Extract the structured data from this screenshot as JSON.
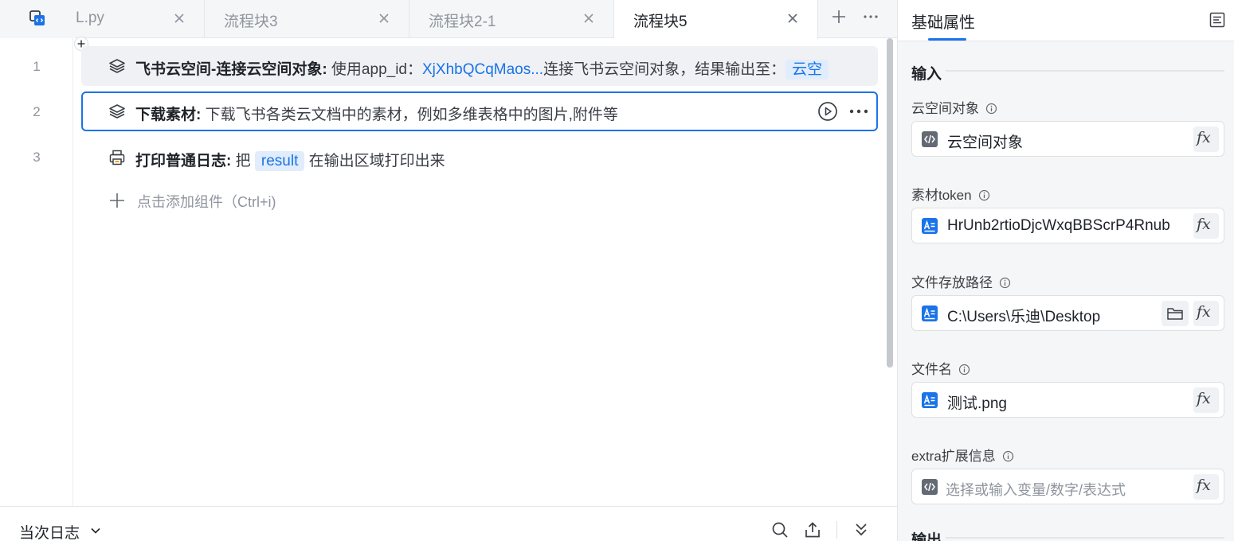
{
  "tabs": [
    {
      "label": "L.py",
      "active": false
    },
    {
      "label": "流程块3",
      "active": false
    },
    {
      "label": "流程块2-1",
      "active": false
    },
    {
      "label": "流程块5",
      "active": true
    }
  ],
  "editor": {
    "line_numbers": [
      "1",
      "2",
      "3"
    ],
    "row1": {
      "title": "飞书云空间-连接云空间对象:",
      "text_before": " 使用app_id：",
      "link": "XjXhbQCqMaos...",
      "text_after": "连接飞书云空间对象，结果输出至：",
      "chip": "云空"
    },
    "row2": {
      "title": "下载素材:",
      "text": " 下载飞书各类云文档中的素材，例如多维表格中的图片,附件等"
    },
    "row3": {
      "title": "打印普通日志:",
      "text_before": " 把",
      "chip": "result",
      "text_after": "在输出区域打印出来"
    },
    "add_component": "点击添加组件（Ctrl+i)"
  },
  "bottom": {
    "log_title": "当次日志"
  },
  "panel": {
    "title": "基础属性",
    "input_section": "输入",
    "output_section": "输出",
    "props": [
      {
        "label": "云空间对象",
        "value": "云空间对象",
        "icon": "code-icon"
      },
      {
        "label": "素材token",
        "value": "HrUnb2rtioDjcWxqBBScrP4Rnub",
        "icon": "text-icon"
      },
      {
        "label": "文件存放路径",
        "value": "C:\\Users\\乐迪\\Desktop",
        "icon": "text-icon"
      },
      {
        "label": "文件名",
        "value": "测试.png",
        "icon": "text-icon"
      },
      {
        "label": "extra扩展信息",
        "placeholder": "选择或输入变量/数字/表达式",
        "icon": "code-icon"
      }
    ],
    "fx_label": "fx"
  },
  "colors": {
    "accent": "#1a73e8",
    "chip_bg": "#e1edfc",
    "panel_bg": "#f5f6f7"
  }
}
